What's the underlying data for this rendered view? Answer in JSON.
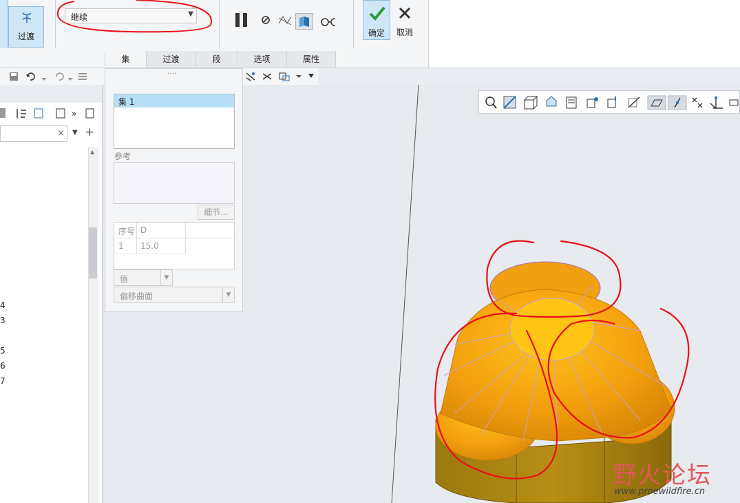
{
  "ribbon": {
    "transition_button": "过渡",
    "mode_select_value": "继续",
    "ok_label": "确定",
    "cancel_label": "取消",
    "tabs": [
      {
        "label": "集",
        "active": true
      },
      {
        "label": "过渡",
        "active": false
      },
      {
        "label": "段",
        "active": false
      },
      {
        "label": "选项",
        "active": false
      },
      {
        "label": "属性",
        "active": false
      }
    ]
  },
  "panel": {
    "sets": [
      "集 1"
    ],
    "references_label": "参考",
    "details_button": "细节...",
    "table_headers": [
      "序号",
      "D"
    ],
    "table_rows": [
      [
        "1",
        "15.0"
      ]
    ],
    "value_select": "值",
    "offset_select": "偏移曲面"
  },
  "model_tree": {
    "row_numbers": [
      "4",
      "3",
      "5",
      "6",
      "7"
    ]
  },
  "watermark": {
    "brand": "野火论坛",
    "url": "www.proewildfire.cn"
  },
  "colors": {
    "accent": "#cfe6f7",
    "selection": "#b6def7",
    "model": "#f0a010",
    "annotation": "#e8101a"
  }
}
